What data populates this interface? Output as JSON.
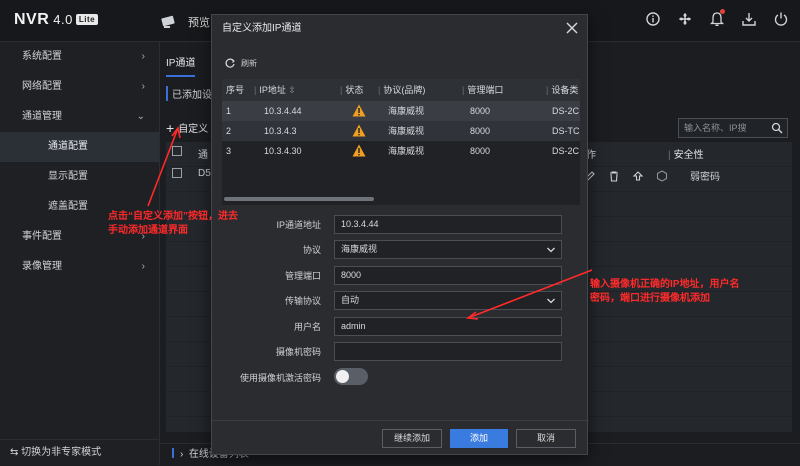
{
  "app": {
    "logo": "NVR",
    "version": "4.0",
    "edition": "Lite",
    "nav_preview": "预览"
  },
  "sidebar": {
    "items": [
      {
        "label": "系统配置",
        "chevron": "›"
      },
      {
        "label": "网络配置",
        "chevron": "›"
      },
      {
        "label": "通道管理",
        "chevron": "⌄"
      }
    ],
    "subitems": [
      {
        "label": "通道配置",
        "active": true
      },
      {
        "label": "显示配置",
        "active": false
      },
      {
        "label": "遮盖配置",
        "active": false
      }
    ],
    "items_after": [
      {
        "label": "事件配置",
        "chevron": "›"
      },
      {
        "label": "录像管理",
        "chevron": "›"
      }
    ],
    "footer": "切换为非专家模式"
  },
  "main": {
    "tab_ip": "IP通道",
    "added_label": "已添加设",
    "custom_add": "自定义",
    "search_placeholder": "输入名称、IP搜",
    "col_left": "通",
    "row_left": "D5",
    "col_operate": "操作",
    "col_security": "安全性",
    "row_security": "弱密码",
    "online_list": "在线设备列表"
  },
  "modal": {
    "title": "自定义添加IP通道",
    "refresh": "刷新",
    "table": {
      "headers": [
        "序号",
        "IP地址",
        "状态",
        "协议(品牌)",
        "管理端口",
        "设备类"
      ],
      "rows": [
        {
          "no": "1",
          "ip": "10.3.4.44",
          "protocol": "海康威视",
          "port": "8000",
          "type": "DS-2C"
        },
        {
          "no": "2",
          "ip": "10.3.4.3",
          "protocol": "海康威视",
          "port": "8000",
          "type": "DS-TC"
        },
        {
          "no": "3",
          "ip": "10.3.4.30",
          "protocol": "海康威视",
          "port": "8000",
          "type": "DS-2C"
        }
      ]
    },
    "form": {
      "ip_label": "IP通道地址",
      "ip_value": "10.3.4.44",
      "protocol_label": "协议",
      "protocol_value": "海康威视",
      "port_label": "管理端口",
      "port_value": "8000",
      "transport_label": "传输协议",
      "transport_value": "自动",
      "user_label": "用户名",
      "user_value": "admin",
      "password_label": "摄像机密码",
      "password_value": "",
      "activate_label": "使用摄像机激活密码"
    },
    "buttons": {
      "continue": "继续添加",
      "add": "添加",
      "cancel": "取消"
    }
  },
  "annotations": {
    "left_1": "点击“自定义添加”按钮，进去",
    "left_2": "手动添加通道界面",
    "right_1": "输入摄像机正确的IP地址，用户名",
    "right_2": "密码，端口进行摄像机添加"
  },
  "colors": {
    "accent": "#3a7be0",
    "warning": "#f0a020",
    "annotation": "#ff2a2a"
  }
}
